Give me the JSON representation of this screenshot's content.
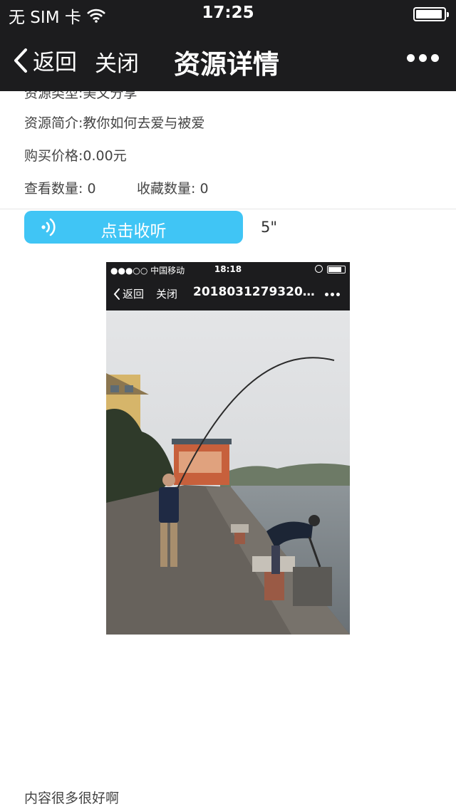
{
  "status_bar": {
    "carrier": "无 SIM 卡",
    "time": "17:25",
    "icons": [
      "wifi-icon",
      "battery-icon"
    ]
  },
  "nav": {
    "back_label": "返回",
    "close_label": "关闭",
    "title": "资源详情",
    "more_icon": "more-dots-icon"
  },
  "info": {
    "type_row": "资源类型:美文分享",
    "intro": "资源简介:教你如何去爱与被爱",
    "price": "购买价格:0.00元",
    "view_count": "查看数量: 0",
    "fav_count": "收藏数量: 0"
  },
  "audio": {
    "label": "点击收听",
    "duration": "5\"",
    "icon": "audio-wave-icon",
    "accent_color": "#40c5f5"
  },
  "embedded_screenshot": {
    "status_carrier": "●●●○○ 中国移动",
    "status_time": "18:18",
    "back_label": "返回",
    "close_label": "关闭",
    "title": "2018031279320..."
  },
  "content_text": "内容很多很好啊",
  "colors": {
    "bar_background": "#1c1c1e",
    "accent": "#40c5f5"
  }
}
